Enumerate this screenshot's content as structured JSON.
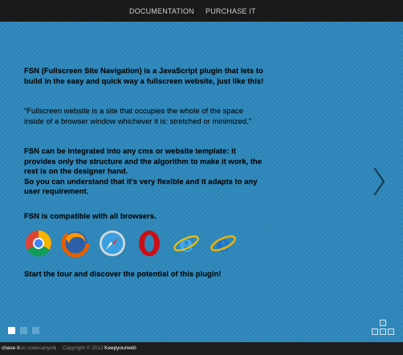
{
  "nav": {
    "documentation": "DOCUMENTATION",
    "purchase": "PURCHASE IT"
  },
  "content": {
    "intro": "FSN (Fullscreen Site Navigation) is a JavaScript plugin that lets to build in the easy and quick way a fullscreen website, just like this!",
    "quote": "“Fullscreen website is a site that occupies the whole of the space inside of a browser window whichever it is: stretched or minimized.”",
    "integration_line1": "FSN can be integrated into any cms or website template: it provides only the structure and the algorithm to make it work, the rest is on the designer hand.",
    "integration_line2": "So you can understand that it’s very flexible and it adapts to any user requirement.",
    "compat": "FSN is compatible with all browsers.",
    "cta": "Start the tour and discover the potential of this plugin!"
  },
  "browsers": [
    "chrome-icon",
    "firefox-icon",
    "safari-icon",
    "opera-icon",
    "ie9-icon",
    "ie-legacy-icon"
  ],
  "pagination": {
    "active_index": 0,
    "count": 3,
    "active_color": "#ffffff",
    "inactive_color": "#5fa6cf"
  },
  "footer": {
    "purchase_link": "chase it",
    "on": "on codecanyon",
    "divider": "|",
    "copyright": "Copyright © 2012",
    "author": "Keepyourweb"
  },
  "colors": {
    "stage": "#2e88bb",
    "bar": "#1a1a1a"
  }
}
